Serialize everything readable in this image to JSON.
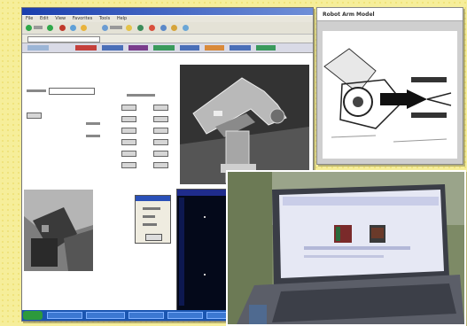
{
  "browser": {
    "menu_items": [
      "File",
      "Edit",
      "View",
      "Favorites",
      "Tools",
      "Help"
    ]
  },
  "diagram": {
    "title": "Robot Arm Model"
  },
  "colors": {
    "background": "#f6ee9a",
    "title_bar": "#1a3fae",
    "taskbar": "#1a55b0",
    "start_button": "#2d9a3c",
    "graph_background": "#04091a"
  }
}
